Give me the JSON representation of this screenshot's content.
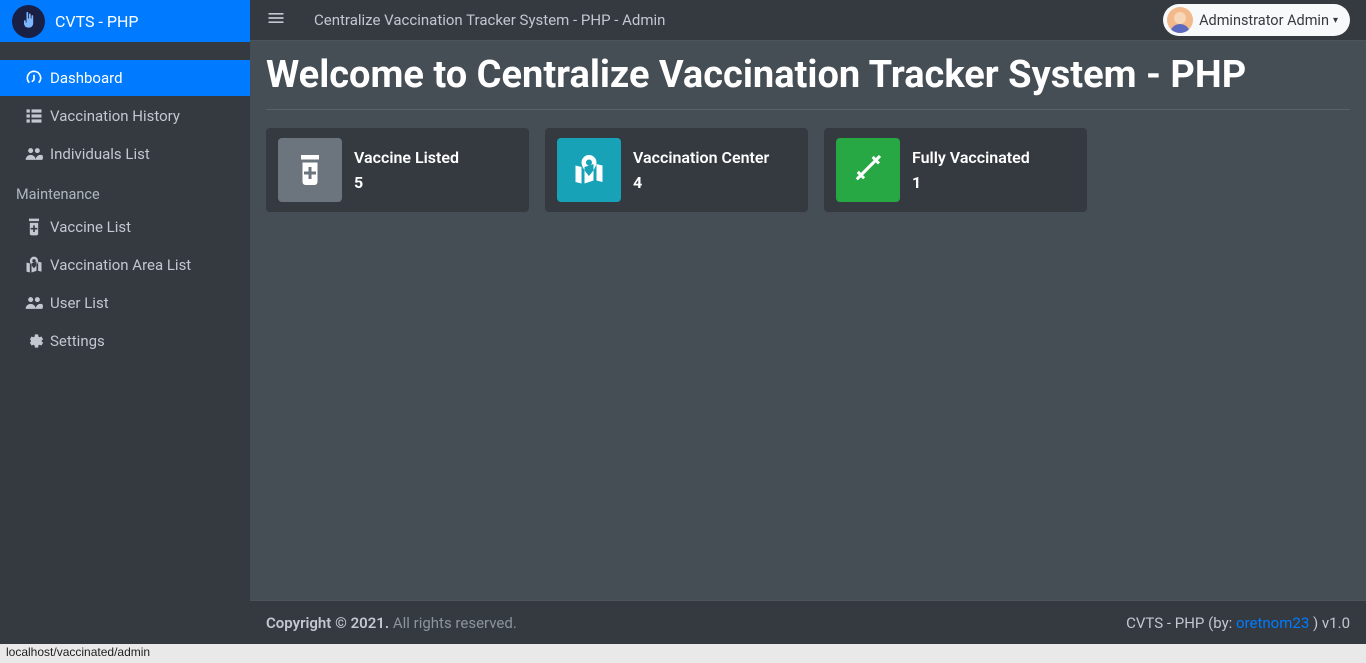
{
  "brand": {
    "title": "CVTS - PHP"
  },
  "sidebar": {
    "items": [
      {
        "label": "Dashboard",
        "active": true
      },
      {
        "label": "Vaccination History"
      },
      {
        "label": "Individuals List"
      }
    ],
    "maintenance_header": "Maintenance",
    "maintenance": [
      {
        "label": "Vaccine List"
      },
      {
        "label": "Vaccination Area List"
      },
      {
        "label": "User List"
      },
      {
        "label": "Settings"
      }
    ]
  },
  "navbar": {
    "title": "Centralize Vaccination Tracker System - PHP - Admin",
    "user_label": "Adminstrator Admin"
  },
  "page": {
    "title": "Welcome to Centralize Vaccination Tracker System - PHP"
  },
  "cards": [
    {
      "label": "Vaccine Listed",
      "value": "5"
    },
    {
      "label": "Vaccination Center",
      "value": "4"
    },
    {
      "label": "Fully Vaccinated",
      "value": "1"
    }
  ],
  "footer": {
    "copyright_strong": "Copyright © 2021.",
    "copyright_rest": " All rights reserved.",
    "right_prefix": "CVTS - PHP (by: ",
    "right_link": "oretnom23",
    "right_suffix": " ) v1.0"
  },
  "statusbar": {
    "text": "localhost/vaccinated/admin"
  }
}
